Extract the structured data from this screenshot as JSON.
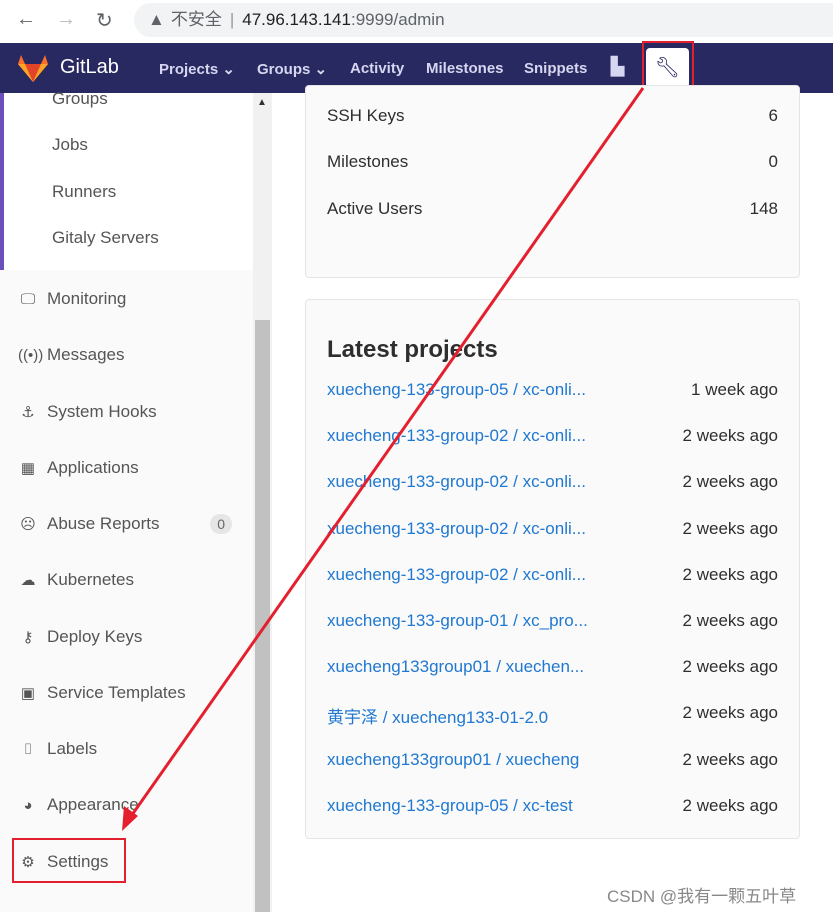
{
  "browser": {
    "back": "←",
    "forward": "→",
    "reload": "↻",
    "security": "不安全",
    "url_host": "47.96.143.141",
    "url_rest": ":9999/admin"
  },
  "topbar": {
    "brand": "GitLab",
    "nav": [
      "Projects ⌄",
      "Groups ⌄",
      "Activity",
      "Milestones",
      "Snippets"
    ]
  },
  "sidebar": {
    "sub_items": [
      "Groups",
      "Jobs",
      "Runners",
      "Gitaly Servers"
    ],
    "items": [
      {
        "label": "Monitoring",
        "icon": "monitor-icon"
      },
      {
        "label": "Messages",
        "icon": "broadcast-icon"
      },
      {
        "label": "System Hooks",
        "icon": "hook-icon"
      },
      {
        "label": "Applications",
        "icon": "grid-icon"
      },
      {
        "label": "Abuse Reports",
        "icon": "sad-face-icon",
        "badge": "0"
      },
      {
        "label": "Kubernetes",
        "icon": "cloud-gear-icon"
      },
      {
        "label": "Deploy Keys",
        "icon": "key-icon"
      },
      {
        "label": "Service Templates",
        "icon": "template-icon"
      },
      {
        "label": "Labels",
        "icon": "labels-icon"
      },
      {
        "label": "Appearance",
        "icon": "palette-icon"
      },
      {
        "label": "Settings",
        "icon": "gear-icon"
      }
    ]
  },
  "stats": [
    {
      "label": "SSH Keys",
      "value": "6"
    },
    {
      "label": "Milestones",
      "value": "0"
    },
    {
      "label": "Active Users",
      "value": "148"
    }
  ],
  "latest": {
    "title": "Latest projects",
    "projects": [
      {
        "name": "xuecheng-133-group-05 / xc-onli...",
        "time": "1 week ago"
      },
      {
        "name": "xuecheng-133-group-02 / xc-onli...",
        "time": "2 weeks ago"
      },
      {
        "name": "xuecheng-133-group-02 / xc-onli...",
        "time": "2 weeks ago"
      },
      {
        "name": "xuecheng-133-group-02 / xc-onli...",
        "time": "2 weeks ago"
      },
      {
        "name": "xuecheng-133-group-02 / xc-onli...",
        "time": "2 weeks ago"
      },
      {
        "name": "xuecheng-133-group-01 / xc_pro...",
        "time": "2 weeks ago"
      },
      {
        "name": "xuecheng133group01 / xuechen...",
        "time": "2 weeks ago"
      },
      {
        "name": "黄宇泽 / xuecheng133-01-2.0",
        "time": "2 weeks ago"
      },
      {
        "name": "xuecheng133group01 / xuecheng",
        "time": "2 weeks ago"
      },
      {
        "name": "xuecheng-133-group-05 / xc-test",
        "time": "2 weeks ago"
      }
    ]
  },
  "watermark": "CSDN @我有一颗五叶草",
  "colors": {
    "topbar": "#292961",
    "link": "#1f78d1",
    "annotation": "#e5202e"
  }
}
